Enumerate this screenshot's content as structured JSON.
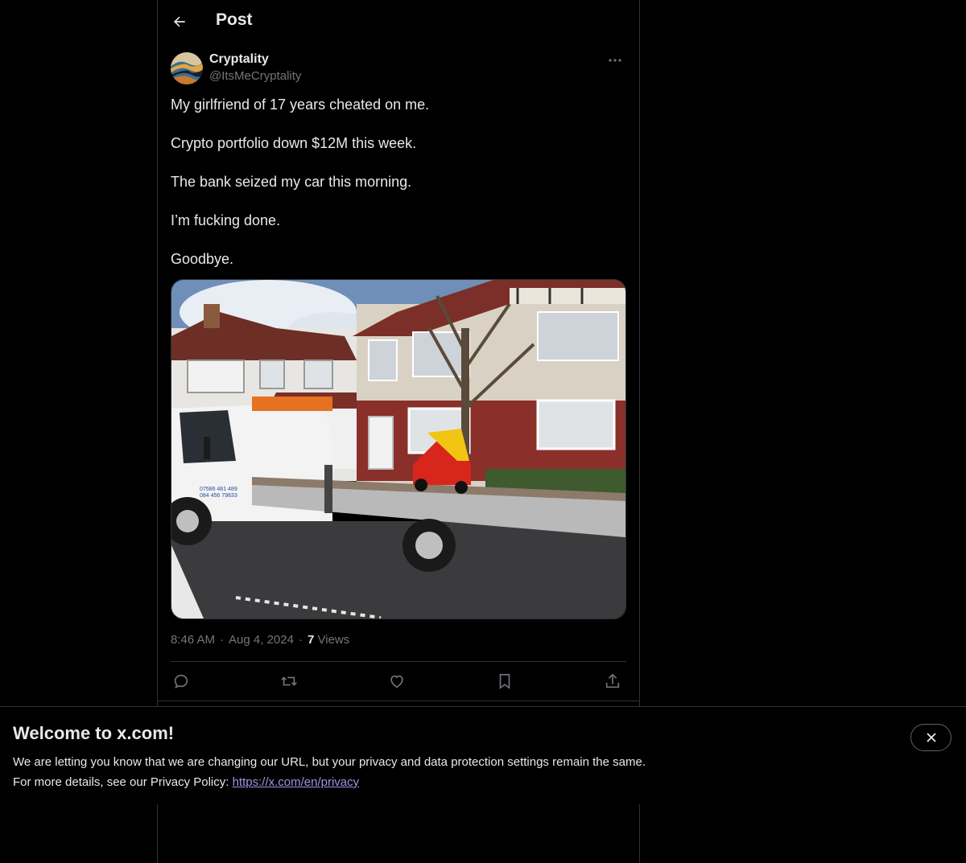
{
  "header": {
    "title": "Post",
    "back_icon": "arrow-left-icon"
  },
  "post": {
    "author": {
      "display_name": "Cryptality",
      "handle": "@ItsMeCryptality",
      "avatar_icon": "avatar-image"
    },
    "more_icon": "more-horizontal-icon",
    "lines": [
      "My girlfriend of 17 years cheated on me.",
      "Crypto portfolio down $12M this week.",
      "The bank seized my car this morning.",
      "I’m fucking done.",
      "Goodbye."
    ],
    "media_icon": "photo-tow-truck-carrying-toy-car",
    "time": "8:46 AM",
    "separator": "·",
    "date": "Aug 4, 2024",
    "views_count": "7",
    "views_label": "Views",
    "actions": [
      {
        "icon": "reply-icon"
      },
      {
        "icon": "repost-icon"
      },
      {
        "icon": "like-icon"
      },
      {
        "icon": "bookmark-icon"
      },
      {
        "icon": "share-icon"
      }
    ]
  },
  "banner": {
    "title": "Welcome to x.com!",
    "line1": "We are letting you know that we are changing our URL, but your privacy and data protection settings remain the same.",
    "line2_prefix": "For more details, see our Privacy Policy: ",
    "link_text": "https://x.com/en/privacy",
    "close_icon": "close-icon"
  },
  "colors": {
    "background": "#000000",
    "text": "#e7e9ea",
    "muted": "#71767b",
    "border": "#2f3336",
    "link": "#a58fe3"
  }
}
